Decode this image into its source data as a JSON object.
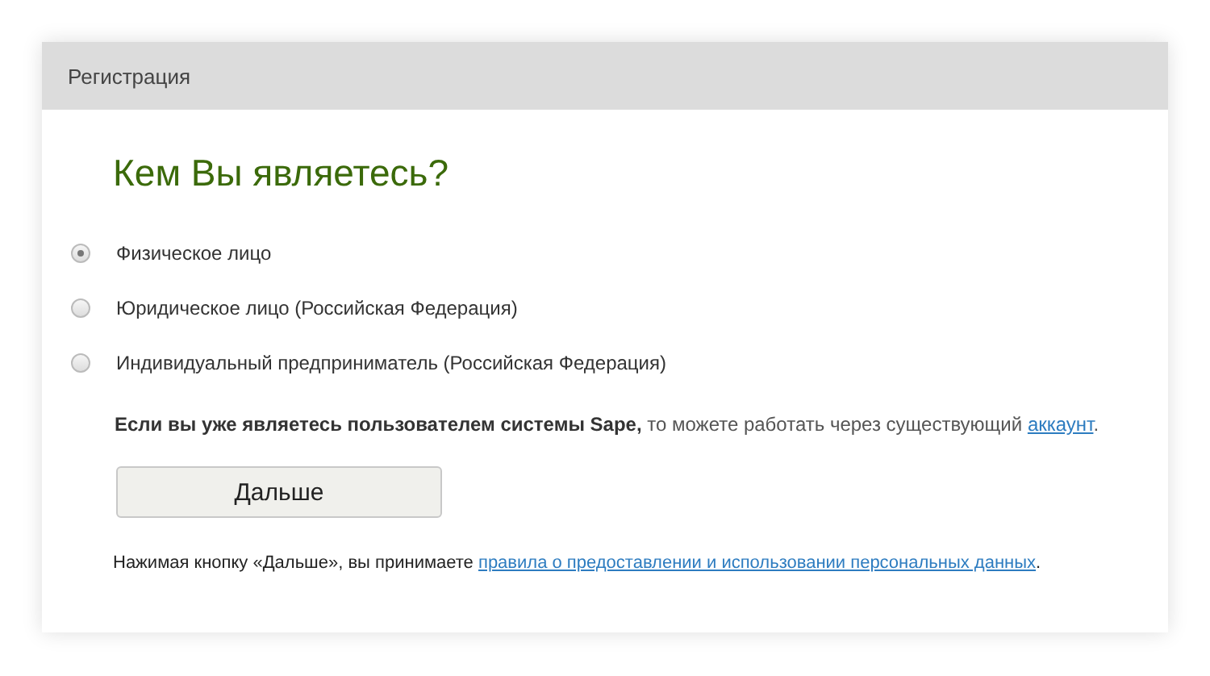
{
  "header": {
    "title": "Регистрация"
  },
  "heading": "Кем Вы являетесь?",
  "options": [
    {
      "label": "Физическое лицо",
      "selected": true
    },
    {
      "label": "Юридическое лицо (Российская Федерация)",
      "selected": false
    },
    {
      "label": "Индивидуальный предприниматель (Российская Федерация)",
      "selected": false
    }
  ],
  "note": {
    "text": "**Если вы уже являетесь пользователем системы Sape,** то можете работать через существующий",
    "link": "аккаунт",
    "end": "."
  },
  "button": "Дальше",
  "footer": {
    "text": "Нажимая кнопку «Дальше», вы принимаете",
    "link": "правила о предоставлении и использовании персональных данных",
    "end": "."
  }
}
